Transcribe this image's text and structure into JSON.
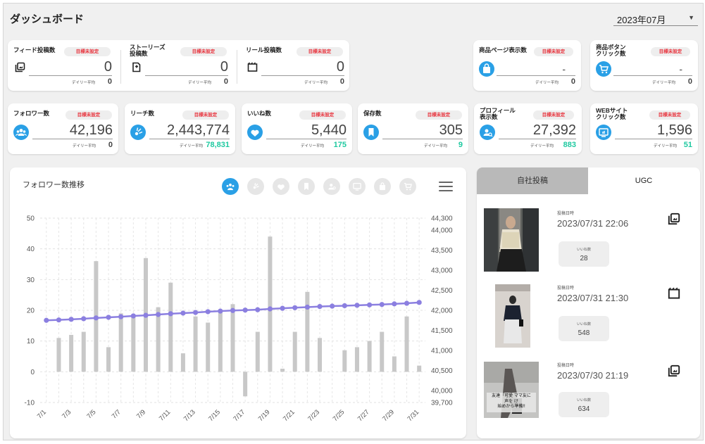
{
  "header": {
    "title": "ダッシュボード",
    "month": "2023年07月"
  },
  "target_badge": "目標未設定",
  "daily_label": "デイリー平均",
  "top_row": [
    {
      "label": "フィード投稿数",
      "icon": "feed-icon",
      "value": "0",
      "daily": "0"
    },
    {
      "label": "ストーリーズ\n投稿数",
      "icon": "story-icon",
      "value": "0",
      "daily": "0"
    },
    {
      "label": "リール投稿数",
      "icon": "reel-icon",
      "value": "0",
      "daily": "0"
    },
    {
      "label": "商品ページ表示数",
      "icon": "bag-icon",
      "value": "-",
      "daily": "0"
    },
    {
      "label": "商品ボタン\nクリック数",
      "icon": "cart-icon",
      "value": "-",
      "daily": "0"
    }
  ],
  "second_row": [
    {
      "label": "フォロワー数",
      "icon": "followers-icon",
      "value": "42,196",
      "daily": "0",
      "daily_color": "#444444"
    },
    {
      "label": "リーチ数",
      "icon": "reach-icon",
      "value": "2,443,774",
      "daily": "78,831",
      "daily_color": "#1ec9a0"
    },
    {
      "label": "いいね数",
      "icon": "heart-icon",
      "value": "5,440",
      "daily": "175",
      "daily_color": "#1ec9a0"
    },
    {
      "label": "保存数",
      "icon": "bookmark-icon",
      "value": "305",
      "daily": "9",
      "daily_color": "#1ec9a0"
    },
    {
      "label": "プロフィール\n表示数",
      "icon": "profile-icon",
      "value": "27,392",
      "daily": "883",
      "daily_color": "#1ec9a0"
    },
    {
      "label": "WEBサイト\nクリック数",
      "icon": "website-icon",
      "value": "1,596",
      "daily": "51",
      "daily_color": "#1ec9a0"
    }
  ],
  "chart_panel": {
    "title": "フォロワー数推移",
    "chips": [
      "followers-icon",
      "reach-icon",
      "heart-icon",
      "bookmark-icon",
      "profile-icon",
      "website-icon",
      "bag-icon",
      "cart-icon"
    ],
    "active_chip": 0,
    "colors": {
      "bar": "#c8c8c8",
      "line": "#8b7fe0",
      "accent": "#2aa0e6"
    }
  },
  "chart_data": {
    "type": "bar+line",
    "x": [
      "7/1",
      "7/2",
      "7/3",
      "7/4",
      "7/5",
      "7/6",
      "7/7",
      "7/8",
      "7/9",
      "7/10",
      "7/11",
      "7/12",
      "7/13",
      "7/14",
      "7/15",
      "7/16",
      "7/17",
      "7/18",
      "7/19",
      "7/20",
      "7/21",
      "7/22",
      "7/23",
      "7/24",
      "7/25",
      "7/26",
      "7/27",
      "7/28",
      "7/29",
      "7/30",
      "7/31"
    ],
    "x_tick_labels": [
      "7/1",
      "7/3",
      "7/5",
      "7/7",
      "7/9",
      "7/11",
      "7/13",
      "7/15",
      "7/17",
      "7/19",
      "7/21",
      "7/23",
      "7/25",
      "7/27",
      "7/29",
      "7/31"
    ],
    "series": [
      {
        "axis": "left",
        "type": "bar",
        "values": [
          0,
          11,
          12,
          13,
          36,
          8,
          19,
          18,
          37,
          21,
          29,
          6,
          18,
          16,
          20,
          22,
          -8,
          13,
          44,
          1,
          13,
          26,
          11,
          0,
          7,
          8,
          10,
          13,
          5,
          18,
          2
        ]
      },
      {
        "axis": "right",
        "type": "line",
        "values": [
          41750,
          41760,
          41775,
          41790,
          41810,
          41825,
          41840,
          41860,
          41875,
          41895,
          41915,
          41930,
          41945,
          41965,
          41980,
          41995,
          42005,
          42015,
          42035,
          42050,
          42065,
          42080,
          42095,
          42105,
          42115,
          42125,
          42135,
          42145,
          42160,
          42175,
          42196
        ]
      }
    ],
    "y_left": {
      "ticks": [
        50,
        40,
        30,
        20,
        10,
        0,
        -10
      ],
      "range": [
        -10,
        50
      ]
    },
    "y_right": {
      "ticks": [
        "44,300",
        "44,000",
        "43,500",
        "43,000",
        "42,500",
        "42,000",
        "41,500",
        "41,000",
        "40,500",
        "40,000",
        "39,700"
      ],
      "range": [
        39700,
        44300
      ]
    },
    "grid": true
  },
  "posts_panel": {
    "tabs": [
      "自社投稿",
      "UGC"
    ],
    "active_tab": 1,
    "posted_label": "投稿日時",
    "likes_label": "いいね数",
    "posts": [
      {
        "date": "2023/07/31 22:06",
        "likes": "28",
        "type_icon": "feed-icon"
      },
      {
        "date": "2023/07/31 21:30",
        "likes": "548",
        "type_icon": "reel-icon"
      },
      {
        "date": "2023/07/30 21:19",
        "likes": "634",
        "type_icon": "feed-icon",
        "thumb_caption": "友達「可愛 ママ友に\n声を け\n始めから準備!!"
      }
    ]
  }
}
